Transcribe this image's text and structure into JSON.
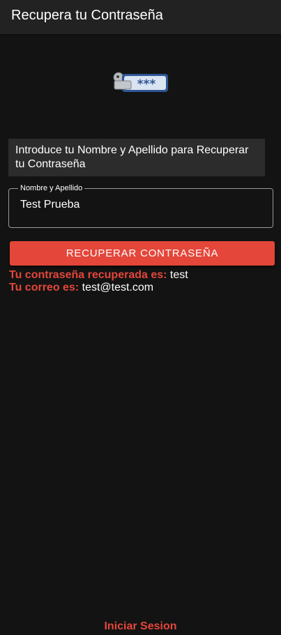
{
  "header": {
    "title": "Recupera tu Contraseña"
  },
  "icon": {
    "name": "password-key-icon",
    "mask_text": "***"
  },
  "instructions": {
    "text": "Introduce tu Nombre y Apellido para Recuperar tu Contraseña"
  },
  "form": {
    "name_label": "Nombre y Apellido",
    "name_value": "Test Prueba"
  },
  "actions": {
    "recover_label": "RECUPERAR CONTRASEÑA"
  },
  "result": {
    "password_label": "Tu contraseña recuperada es:",
    "password_value": "test",
    "email_label": "Tu correo es:",
    "email_value": "test@test.com"
  },
  "footer": {
    "login_link": "Iniciar Sesion"
  },
  "colors": {
    "accent": "#e4463a",
    "background": "#131313",
    "header": "#222222",
    "panel": "#2c2c2c"
  }
}
